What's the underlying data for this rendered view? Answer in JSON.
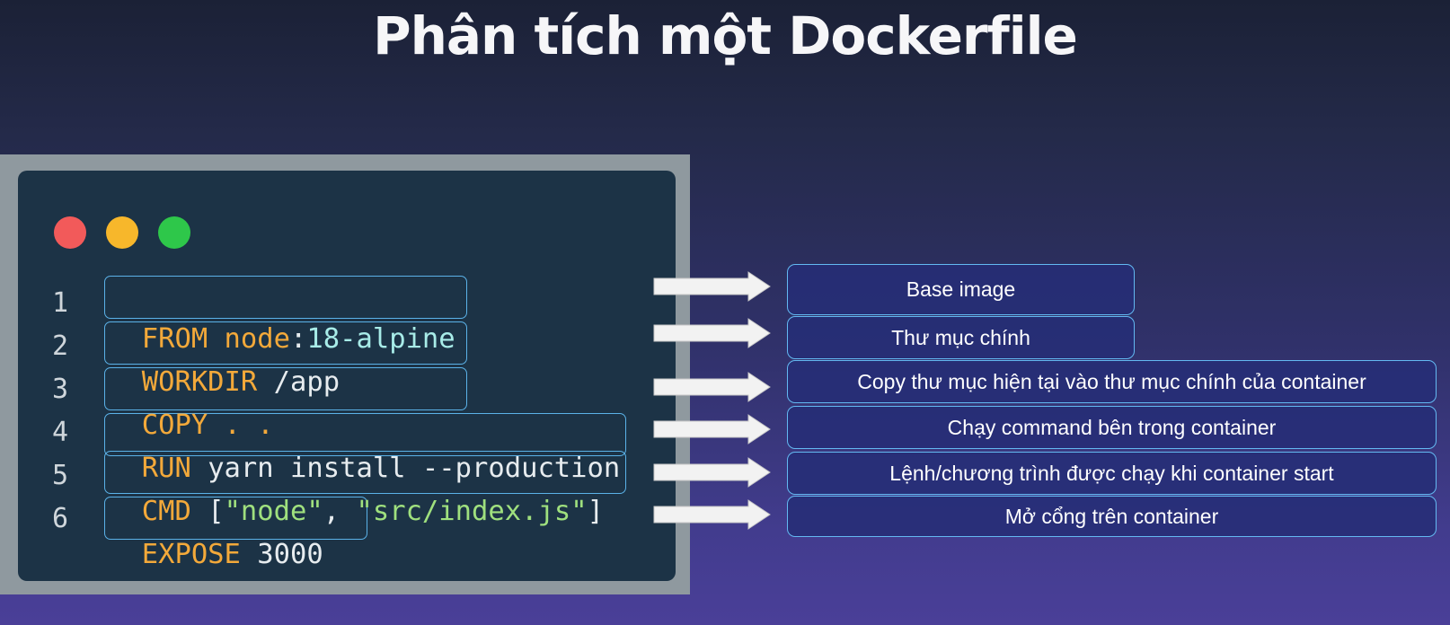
{
  "title": "Phân tích một Dockerfile",
  "window_dots": [
    "close",
    "minimize",
    "maximize"
  ],
  "colors": {
    "keyword": "#f3a93a",
    "accent": "#a8ece8",
    "string": "#9fe07e",
    "box_border": "#5bb2e8"
  },
  "code_lines": [
    {
      "num": "1",
      "parts": [
        {
          "t": "FROM",
          "c": "kw"
        },
        {
          "t": " node",
          "c": "kw"
        },
        {
          "t": ":",
          "c": "pl"
        },
        {
          "t": "18-alpine",
          "c": "ac"
        }
      ]
    },
    {
      "num": "2",
      "parts": [
        {
          "t": "WORKDIR",
          "c": "kw"
        },
        {
          "t": " /app",
          "c": "pl"
        }
      ]
    },
    {
      "num": "3",
      "parts": [
        {
          "t": "COPY",
          "c": "kw"
        },
        {
          "t": " . .",
          "c": "kw"
        }
      ]
    },
    {
      "num": "4",
      "parts": [
        {
          "t": "RUN",
          "c": "kw"
        },
        {
          "t": " yarn install --production",
          "c": "pl"
        }
      ]
    },
    {
      "num": "5",
      "parts": [
        {
          "t": "CMD",
          "c": "kw"
        },
        {
          "t": " [",
          "c": "pl"
        },
        {
          "t": "\"node\"",
          "c": "st"
        },
        {
          "t": ", ",
          "c": "pl"
        },
        {
          "t": "\"src/index.js\"",
          "c": "st"
        },
        {
          "t": "]",
          "c": "pl"
        }
      ]
    },
    {
      "num": "6",
      "parts": [
        {
          "t": "EXPOSE",
          "c": "kw"
        },
        {
          "t": " 3000",
          "c": "pl"
        }
      ]
    }
  ],
  "descriptions": [
    "Base image",
    "Thư mục chính",
    "Copy thư mục hiện tại vào thư mục chính của container",
    "Chạy command bên trong container",
    "Lệnh/chương trình được chạy khi container start",
    "Mở cổng trên container"
  ]
}
